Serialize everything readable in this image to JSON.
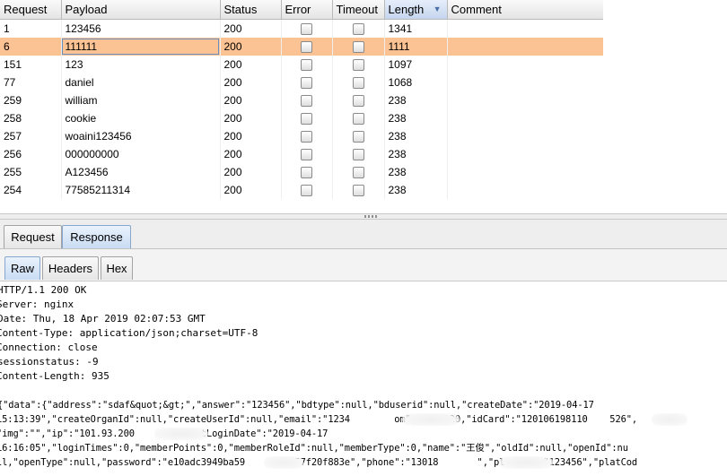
{
  "results": {
    "columns": [
      "Request",
      "Payload",
      "Status",
      "Error",
      "Timeout",
      "Length",
      "Comment"
    ],
    "sorted_column": "Length",
    "rows": [
      {
        "request": "1",
        "payload": "123456",
        "status": "200",
        "length": "1341",
        "selected": false
      },
      {
        "request": "6",
        "payload": "111111",
        "status": "200",
        "length": "1111",
        "selected": true
      },
      {
        "request": "151",
        "payload": "123",
        "status": "200",
        "length": "1097",
        "selected": false
      },
      {
        "request": "77",
        "payload": "daniel",
        "status": "200",
        "length": "1068",
        "selected": false
      },
      {
        "request": "259",
        "payload": "william",
        "status": "200",
        "length": "238",
        "selected": false
      },
      {
        "request": "258",
        "payload": "cookie",
        "status": "200",
        "length": "238",
        "selected": false
      },
      {
        "request": "257",
        "payload": "woaini123456",
        "status": "200",
        "length": "238",
        "selected": false
      },
      {
        "request": "256",
        "payload": "000000000",
        "status": "200",
        "length": "238",
        "selected": false
      },
      {
        "request": "255",
        "payload": "A123456",
        "status": "200",
        "length": "238",
        "selected": false
      },
      {
        "request": "254",
        "payload": "77585211314",
        "status": "200",
        "length": "238",
        "selected": false
      }
    ]
  },
  "tabs_main": [
    {
      "label": "Request",
      "active": false
    },
    {
      "label": "Response",
      "active": true
    }
  ],
  "tabs_view": [
    {
      "label": "Raw",
      "active": true
    },
    {
      "label": "Headers",
      "active": false
    },
    {
      "label": "Hex",
      "active": false
    }
  ],
  "response": {
    "headers": [
      "HTTP/1.1 200 OK",
      "Server: nginx",
      "Date: Thu, 18 Apr 2019 02:07:53 GMT",
      "Content-Type: application/json;charset=UTF-8",
      "Connection: close",
      "sessionstatus: -9",
      "Content-Length: 935"
    ],
    "body": [
      "{\"data\":{\"address\":\"sdaf&quot;&gt;\",\"answer\":\"123456\",\"bdtype\":null,\"bduserid\":null,\"createDate\":\"2019-04-17",
      "15:13:39\",\"createOrganId\":null,\"createUserId\":null,\"email\":\"1234        om\",\"id\":120,\"idCard\":\"120106198110    526\",",
      "\"img\":\"\",\"ip\":\"101.93.200      \",\"lastLoginDate\":\"2019-04-17",
      "16:16:05\",\"loginTimes\":0,\"memberPoints\":0,\"memberRoleId\":null,\"memberType\":0,\"name\":\"王俊\",\"oldId\":null,\"openId\":nu",
      "ll,\"openType\":null,\"password\":\"e10adc3949ba59      6e057f20f883e\",\"phone\":\"13018       \",\"plainpw\":\"123456\",\"platCod"
    ]
  },
  "colors": {
    "selected_row": "#fbc293",
    "active_tab": "#c9dcf3",
    "header_bg": "#e4e4e4"
  },
  "icons": {
    "sort": "sort-descending-icon",
    "checkbox": "checkbox-unchecked"
  }
}
